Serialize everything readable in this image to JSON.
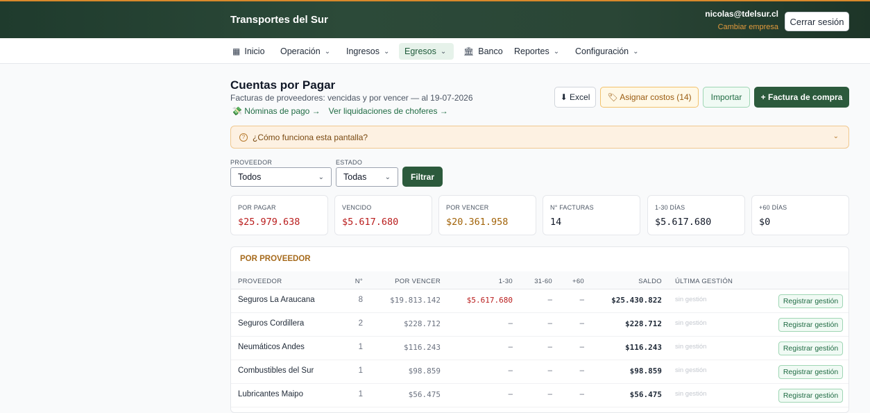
{
  "header": {
    "brand": "Transportes del Sur",
    "user_email": "nicolas@tdelsur.cl",
    "switch_company": "Cambiar empresa",
    "logout": "Cerrar sesión"
  },
  "nav": [
    {
      "label": "Inicio",
      "icon": "grid-icon",
      "dropdown": false
    },
    {
      "label": "Operación",
      "dropdown": true
    },
    {
      "label": "Ingresos",
      "dropdown": true
    },
    {
      "label": "Egresos",
      "dropdown": true,
      "active": true
    },
    {
      "label": "Banco",
      "icon": "bank-icon",
      "dropdown": false
    },
    {
      "label": "Reportes",
      "dropdown": true
    },
    {
      "label": "Configuración",
      "dropdown": true
    }
  ],
  "page": {
    "title": "Cuentas por Pagar",
    "subtitle": "Facturas de proveedores: vencidas y por vencer — al 19-07-2026",
    "link_payroll": "💸 Nóminas de pago →",
    "link_drivers": "Ver liquidaciones de choferes →"
  },
  "actions": {
    "excel": "⬇ Excel",
    "assign": "🏷 Asignar costos (14)",
    "import": "Importar",
    "invoice": "+ Factura de compra"
  },
  "help": {
    "text": "¿Cómo funciona esta pantalla?"
  },
  "filters": {
    "provider_label": "PROVEEDOR",
    "provider_value": "Todos",
    "status_label": "ESTADO",
    "status_value": "Todas",
    "filter_button": "Filtrar"
  },
  "stats": [
    {
      "label": "POR PAGAR",
      "value": "$25.979.638",
      "color": "#b91c1c"
    },
    {
      "label": "VENCIDO",
      "value": "$5.617.680",
      "color": "#b91c1c"
    },
    {
      "label": "POR VENCER",
      "value": "$20.361.958",
      "color": "#a16207"
    },
    {
      "label": "N° FACTURAS",
      "value": "14",
      "color": "#111827"
    },
    {
      "label": "1-30 DÍAS",
      "value": "$5.617.680",
      "color": "#111827"
    },
    {
      "label": "+60 DÍAS",
      "value": "$0",
      "color": "#111827"
    }
  ],
  "table": {
    "title": "POR PROVEEDOR",
    "headers": {
      "provider": "PROVEEDOR",
      "count": "N°",
      "upcoming": "POR VENCER",
      "d1_30": "1-30",
      "d31_60": "31-60",
      "d60": "+60",
      "balance": "SALDO",
      "last_action": "ÚLTIMA GESTIÓN"
    },
    "action_label": "Registrar gestión",
    "rows": [
      {
        "provider": "Seguros La Araucana",
        "count": "8",
        "upcoming": "$19.813.142",
        "d1_30": "$5.617.680",
        "d31_60": "–",
        "d60": "–",
        "balance": "$25.430.822",
        "last_action": "sin gestión"
      },
      {
        "provider": "Seguros Cordillera",
        "count": "2",
        "upcoming": "$228.712",
        "d1_30": "–",
        "d31_60": "–",
        "d60": "–",
        "balance": "$228.712",
        "last_action": "sin gestión"
      },
      {
        "provider": "Neumáticos Andes",
        "count": "1",
        "upcoming": "$116.243",
        "d1_30": "–",
        "d31_60": "–",
        "d60": "–",
        "balance": "$116.243",
        "last_action": "sin gestión"
      },
      {
        "provider": "Combustibles del Sur",
        "count": "1",
        "upcoming": "$98.859",
        "d1_30": "–",
        "d31_60": "–",
        "d60": "–",
        "balance": "$98.859",
        "last_action": "sin gestión"
      },
      {
        "provider": "Lubricantes Maipo",
        "count": "1",
        "upcoming": "$56.475",
        "d1_30": "–",
        "d31_60": "–",
        "d60": "–",
        "balance": "$56.475",
        "last_action": "sin gestión"
      }
    ]
  }
}
